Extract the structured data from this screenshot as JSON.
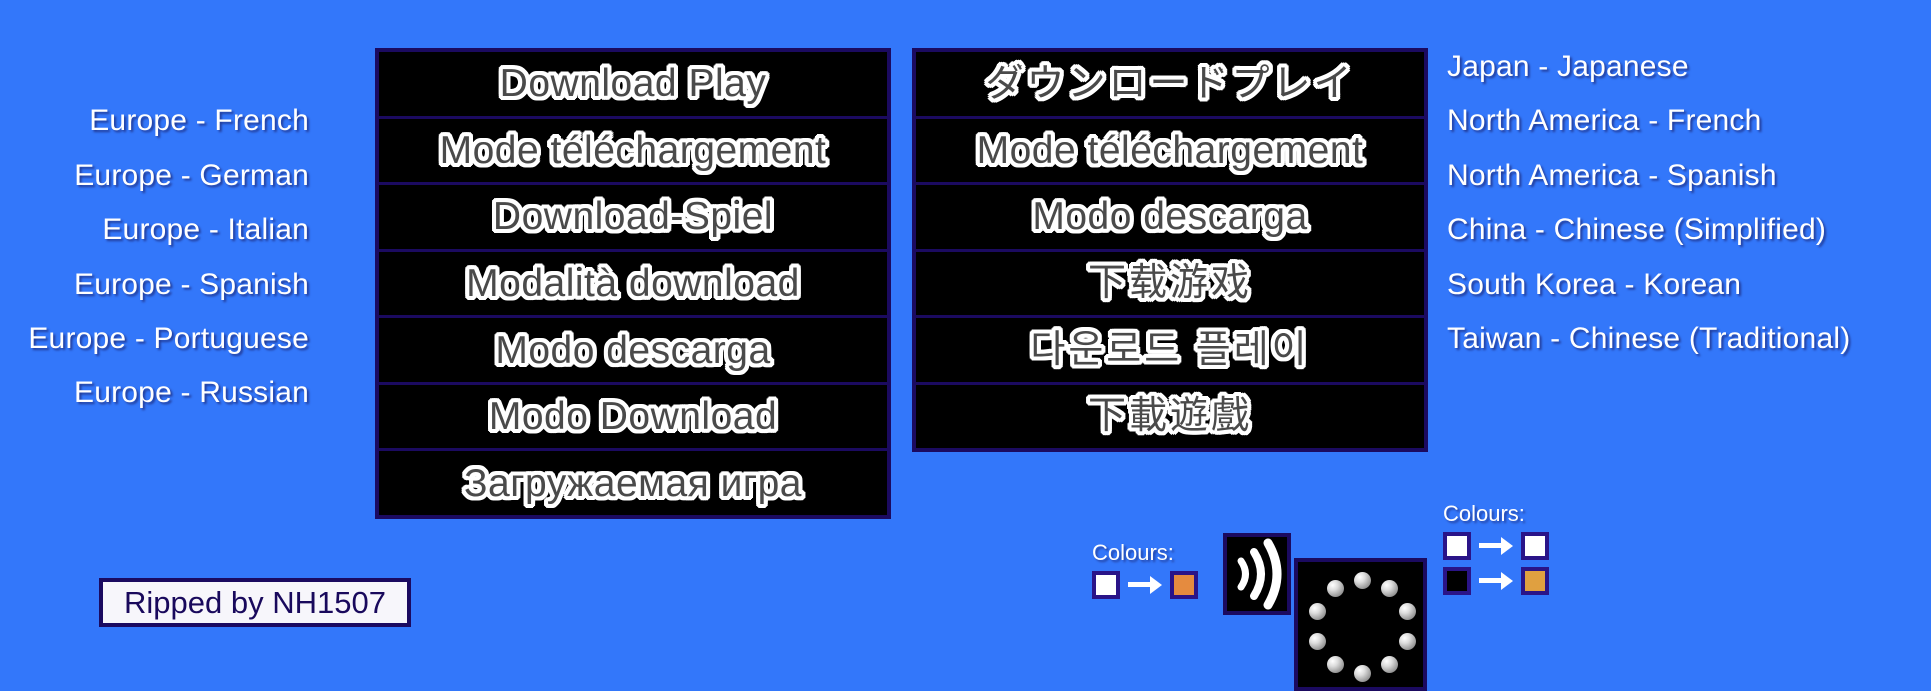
{
  "meta": {
    "background_color": "#3377fa",
    "panel_background": "#000000",
    "panel_border_color": "#1b0a60",
    "title_fill_color": "#4a4a4a",
    "title_outline_color": "#ffffff",
    "label_color": "#ffffff"
  },
  "left_panel": {
    "rows": [
      {
        "title": "Download Play",
        "region": ""
      },
      {
        "title": "Mode téléchargement",
        "region": "Europe - French"
      },
      {
        "title": "Download-Spiel",
        "region": "Europe - German"
      },
      {
        "title": "Modalità download",
        "region": "Europe - Italian"
      },
      {
        "title": "Modo descarga",
        "region": "Europe - Spanish"
      },
      {
        "title": "Modo Download",
        "region": "Europe - Portuguese"
      },
      {
        "title": "Загружаемая игра",
        "region": "Europe - Russian"
      }
    ]
  },
  "right_panel": {
    "rows": [
      {
        "title": "ダウンロードプレイ",
        "region": "Japan - Japanese"
      },
      {
        "title": "Mode téléchargement",
        "region": "North America - French"
      },
      {
        "title": "Modo descarga",
        "region": "North America - Spanish"
      },
      {
        "title": "下载游戏",
        "region": "China - Chinese (Simplified)"
      },
      {
        "title": "다운로드 플레이",
        "region": "South Korea - Korean"
      },
      {
        "title": "下載遊戲",
        "region": "Taiwan - Chinese (Traditional)"
      }
    ]
  },
  "credit": {
    "text": "Ripped by NH1507"
  },
  "legend_wireless": {
    "title": "Colours:",
    "rows": [
      {
        "from": "#ffffff",
        "to": "#e58b3f"
      }
    ]
  },
  "legend_spinner": {
    "title": "Colours:",
    "rows": [
      {
        "from": "#ffffff",
        "to": "#ffffff"
      },
      {
        "from": "#000000",
        "to": "#e0a040"
      }
    ]
  },
  "icons": {
    "wireless": "wireless-signal-icon",
    "spinner": "loading-spinner-icon"
  }
}
